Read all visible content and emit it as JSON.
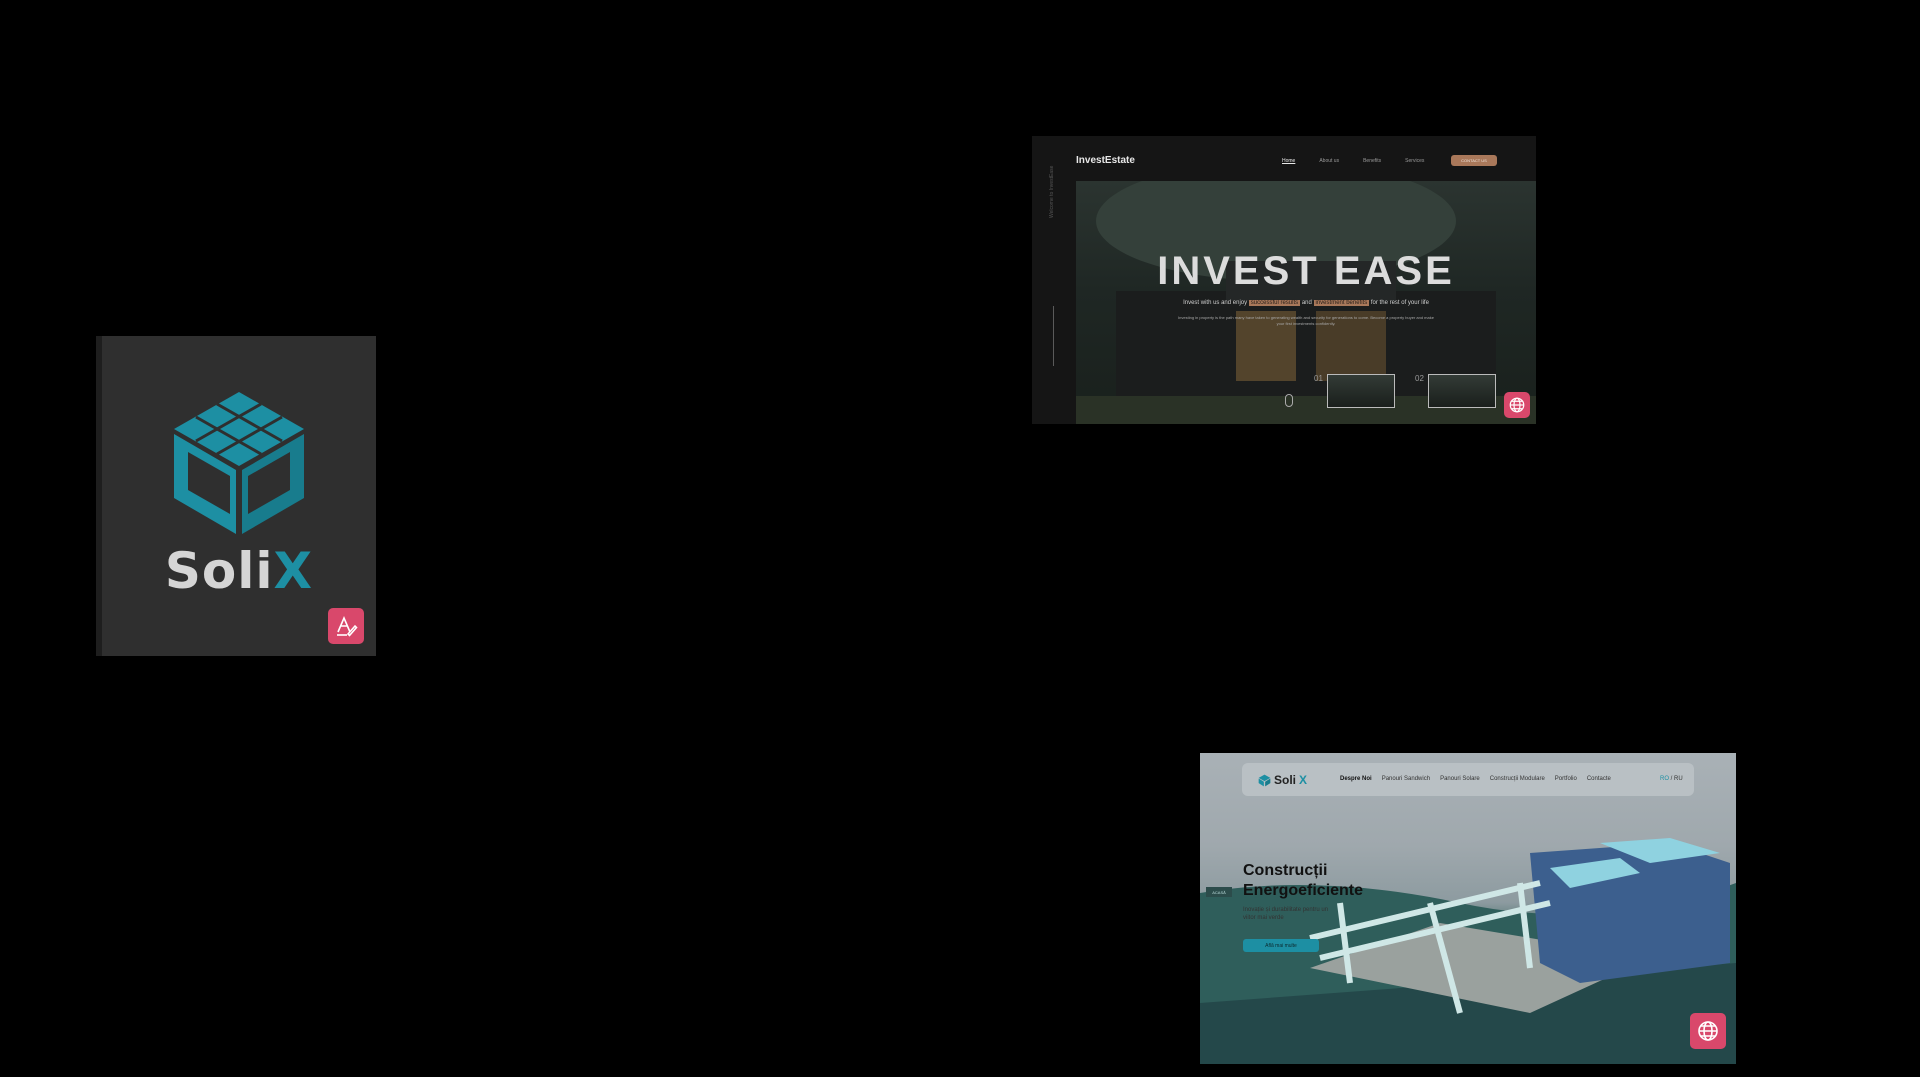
{
  "solix_logo": {
    "brand_main": "Soli",
    "brand_accent": "X",
    "cube_color": "#1d8fa3",
    "badge_icon": "signature-icon"
  },
  "investestate": {
    "brand": "InvestEstate",
    "nav": [
      "Home",
      "About us",
      "Benefits",
      "Services"
    ],
    "contact_label": "CONTACT US",
    "side_text": "Welcome to InvestEase",
    "headline": "INVEST EASE",
    "sub_prefix": "Invest with us and enjoy",
    "sub_hl1": "successful results",
    "sub_mid": "and",
    "sub_hl2": "investment benefits",
    "sub_suffix": "for the rest of your life",
    "paragraph": "Investing in property is the path many have taken to generating wealth and security for generations to come. Become a property buyer and make your first investments confidently.",
    "slide1_num": "01",
    "slide2_num": "02",
    "accent": "#a9785a",
    "badge_icon": "globe-icon"
  },
  "solix_site": {
    "brand_main": "Soli",
    "brand_accent": "X",
    "nav": [
      "Despre Noi",
      "Panouri Sandwich",
      "Panouri Solare",
      "Construcții Modulare",
      "Portfolio",
      "Contacte"
    ],
    "lang_current": "RO",
    "lang_sep": " / ",
    "lang_other": "RU",
    "title_line1": "Construcții",
    "title_line2": "Energoeficiente",
    "subtitle": "Inovație și durabilitate pentru un viitor mai verde",
    "cta_label": "Află mai multe",
    "side_label": "ACASĂ",
    "accent": "#1d8fa3",
    "badge_icon": "globe-icon"
  }
}
